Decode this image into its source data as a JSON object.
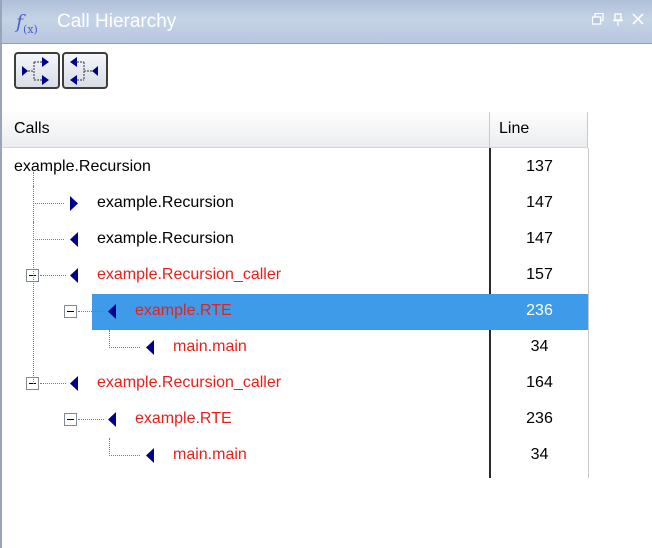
{
  "title": "Call Hierarchy",
  "title_icon": "fx-function-icon",
  "window_controls": [
    "restore-icon",
    "pin-icon",
    "close-icon"
  ],
  "toolbar": {
    "buttons": [
      {
        "name": "show-callees-button",
        "icon": "callees-arrows-icon"
      },
      {
        "name": "show-callers-button",
        "icon": "callers-arrows-icon"
      }
    ]
  },
  "columns": {
    "calls": "Calls",
    "line": "Line"
  },
  "rows": [
    {
      "label": "example.Recursion",
      "line": "137",
      "depth": 0,
      "color": "black",
      "arrow": "none",
      "expander": false,
      "selected": false
    },
    {
      "label": "example.Recursion",
      "line": "147",
      "depth": 1,
      "color": "black",
      "arrow": "right",
      "expander": false,
      "selected": false
    },
    {
      "label": "example.Recursion",
      "line": "147",
      "depth": 1,
      "color": "black",
      "arrow": "left",
      "expander": false,
      "selected": false
    },
    {
      "label": "example.Recursion_caller",
      "line": "157",
      "depth": 1,
      "color": "red",
      "arrow": "left",
      "expander": true,
      "selected": false
    },
    {
      "label": "example.RTE",
      "line": "236",
      "depth": 2,
      "color": "red",
      "arrow": "left",
      "expander": true,
      "selected": true
    },
    {
      "label": "main.main",
      "line": "34",
      "depth": 3,
      "color": "red",
      "arrow": "left",
      "expander": false,
      "selected": false
    },
    {
      "label": "example.Recursion_caller",
      "line": "164",
      "depth": 1,
      "color": "red",
      "arrow": "left",
      "expander": true,
      "selected": false
    },
    {
      "label": "example.RTE",
      "line": "236",
      "depth": 2,
      "color": "red",
      "arrow": "left",
      "expander": true,
      "selected": false
    },
    {
      "label": "main.main",
      "line": "34",
      "depth": 3,
      "color": "red",
      "arrow": "left",
      "expander": false,
      "selected": false
    }
  ],
  "colors": {
    "selection": "#3d9be9",
    "caller_text": "#e8201c",
    "arrow": "#00008b"
  }
}
